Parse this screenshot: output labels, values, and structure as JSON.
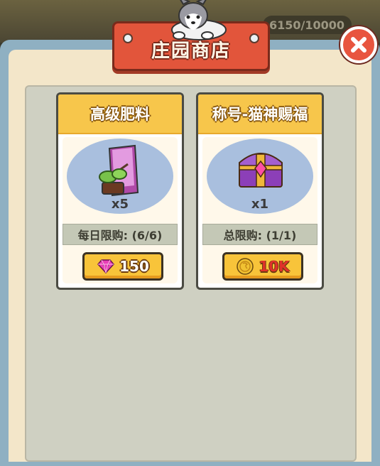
{
  "header": {
    "title": "庄园商店",
    "counter": "6150/10000"
  },
  "items": [
    {
      "name": "高级肥料",
      "quantity": "x5",
      "limit": "每日限购: (6/6)",
      "currency_icon": "gem-icon",
      "price": "150"
    },
    {
      "name": "称号-猫神赐福",
      "quantity": "x1",
      "limit": "总限购: (1/1)",
      "currency_icon": "coin-icon",
      "price": "10K"
    }
  ],
  "colors": {
    "banner": "#e2553b",
    "card_header": "#f7c64b",
    "button": "#f8c43a",
    "close": "#e8553f"
  }
}
